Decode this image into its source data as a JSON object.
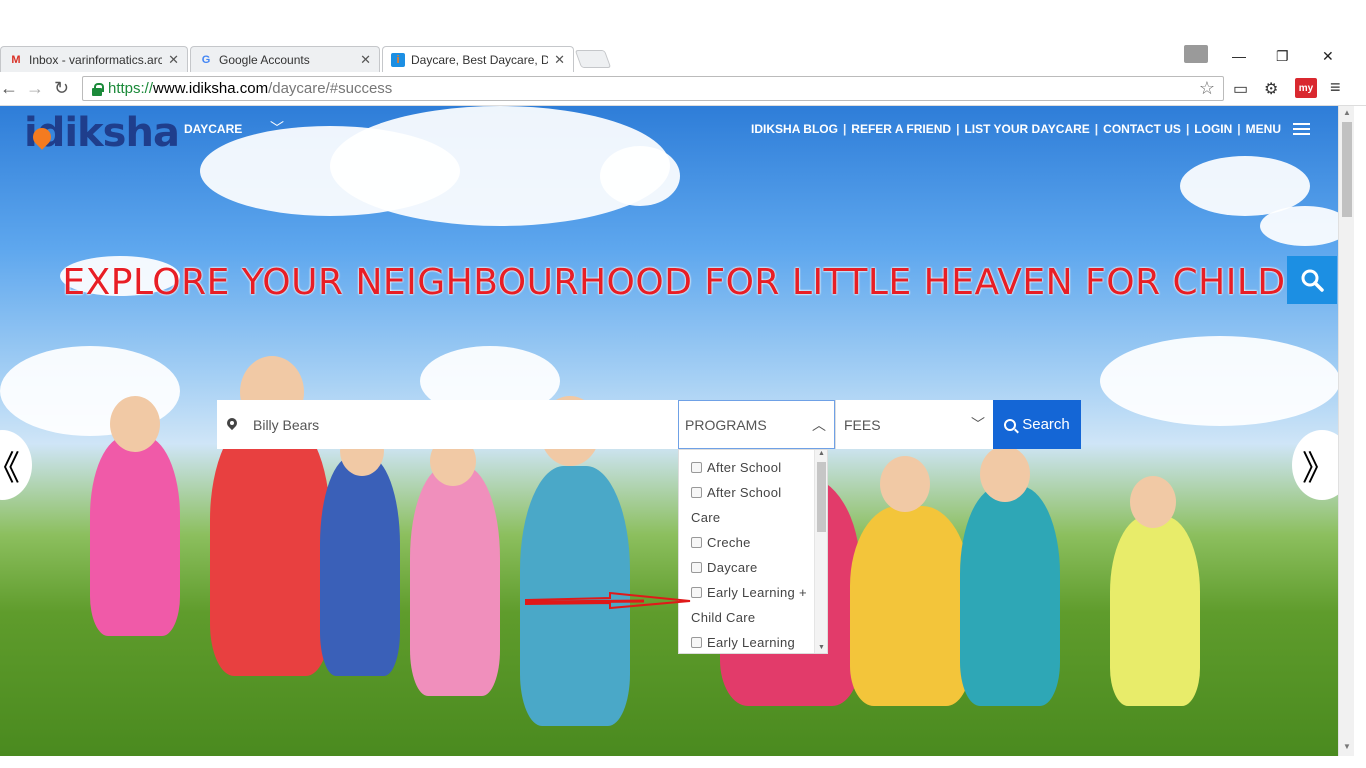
{
  "browser": {
    "tabs": [
      {
        "title": "Inbox - varinformatics.arch",
        "favicon": "gmail-icon"
      },
      {
        "title": "Google Accounts",
        "favicon": "google-icon"
      },
      {
        "title": "Daycare, Best Daycare, Day",
        "favicon": "idiksha-icon"
      }
    ],
    "url": {
      "scheme": "https://",
      "host": "www.idiksha.com",
      "path": "/daycare/#success"
    }
  },
  "header": {
    "logo": "idiksha",
    "daycare_menu": "DAYCARE",
    "nav_links": [
      "IDIKSHA BLOG",
      "REFER A FRIEND",
      "LIST YOUR DAYCARE",
      "CONTACT US",
      "LOGIN",
      "MENU"
    ]
  },
  "hero": {
    "headline": "EXPLORE YOUR NEIGHBOURHOOD FOR LITTLE HEAVEN FOR CHILD"
  },
  "search_form": {
    "location_value": "Billy Bears",
    "programs_label": "PROGRAMS",
    "fees_label": "FEES",
    "search_label": "Search",
    "program_options": [
      "After School",
      "After School Care",
      "Creche",
      "Daycare",
      "Early Learning + Child Care",
      "Early Learning"
    ]
  },
  "colors": {
    "brand_blue": "#1f3e8c",
    "brand_orange": "#f47b20",
    "headline_red": "#e81e25",
    "search_button": "#1466d6",
    "search_fab": "#1c8fe3"
  }
}
